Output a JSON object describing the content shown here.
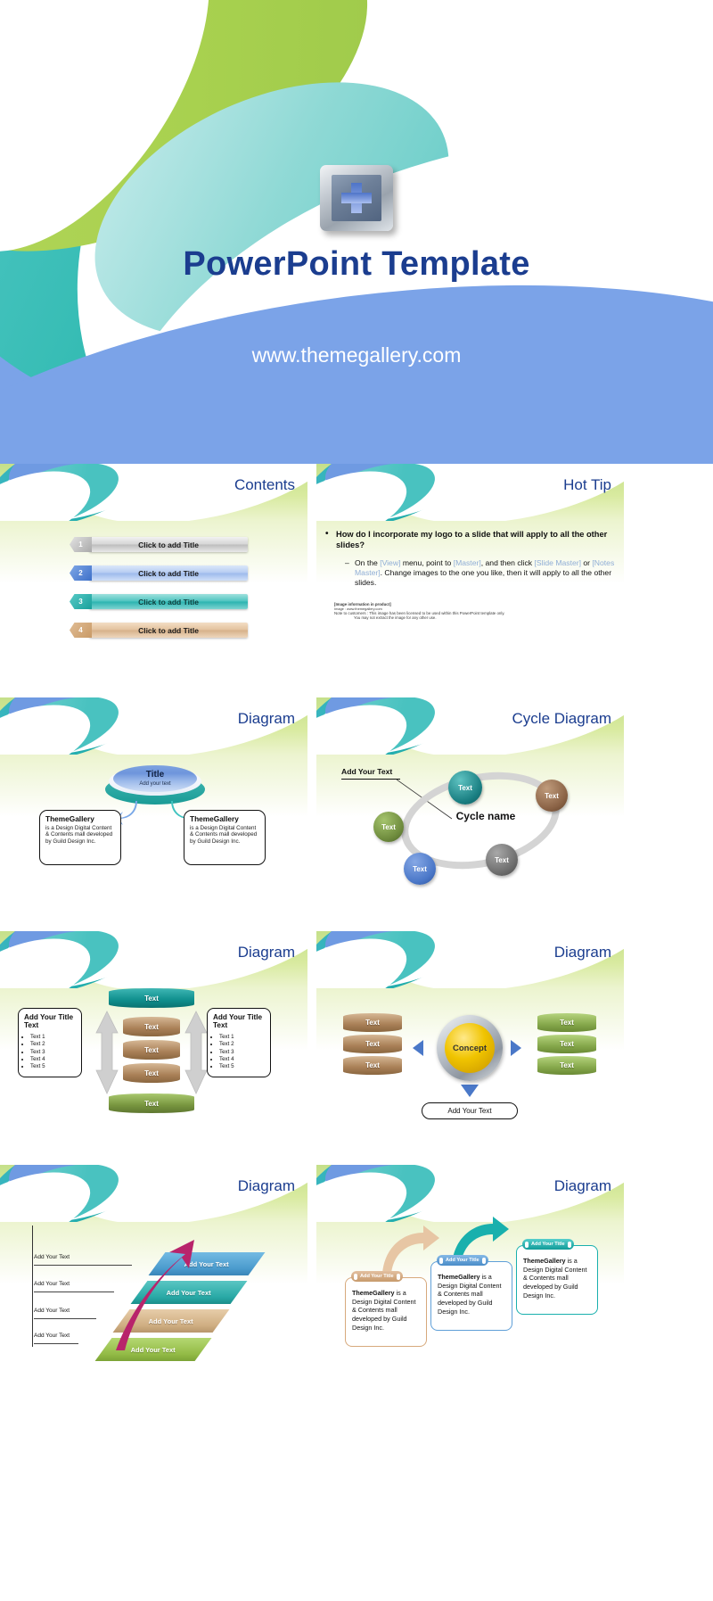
{
  "cover": {
    "title": "PowerPoint Template",
    "url": "www.themegallery.com",
    "logo_icon": "plus-badge-icon"
  },
  "slides": [
    {
      "title": "Contents",
      "items": [
        {
          "num": "1",
          "label": "Click to add Title"
        },
        {
          "num": "2",
          "label": "Click to add Title"
        },
        {
          "num": "3",
          "label": "Click to add Title"
        },
        {
          "num": "4",
          "label": "Click to add Title"
        }
      ]
    },
    {
      "title": "Hot Tip",
      "question": "How do I incorporate my logo to a slide that will apply to all the other slides?",
      "answer_parts": [
        {
          "text": "On the ",
          "placeholder": false
        },
        {
          "text": "[View]",
          "placeholder": true
        },
        {
          "text": " menu, point to ",
          "placeholder": false
        },
        {
          "text": "[Master]",
          "placeholder": true
        },
        {
          "text": ", and then click ",
          "placeholder": false
        },
        {
          "text": "[Slide Master]",
          "placeholder": true
        },
        {
          "text": " or ",
          "placeholder": false
        },
        {
          "text": "[Notes Master]",
          "placeholder": true
        },
        {
          "text": ". Change images to the one you like, then it will apply to all the other slides.",
          "placeholder": false
        }
      ],
      "notes": {
        "heading": "[Image information in product]",
        "line1": "Image : www.themegallery.com",
        "line2": "Note to customers : This image has been licensed to be used within this PowerPoint template only.",
        "line3": "You may not extract the image for any other use."
      }
    },
    {
      "title": "Diagram",
      "center": {
        "title": "Title",
        "subtitle": "Add your text"
      },
      "boxes": [
        {
          "heading": "ThemeGallery",
          "body": "is a Design Digital Content & Contents mall developed by Guild Design Inc."
        },
        {
          "heading": "ThemeGallery",
          "body": "is a Design Digital Content & Contents mall developed by Guild Design Inc."
        }
      ]
    },
    {
      "title": "Cycle Diagram",
      "callout": "Add Your Text",
      "cycle_name": "Cycle name",
      "nodes": [
        {
          "label": "Text",
          "color": "#1a7f82"
        },
        {
          "label": "Text",
          "color": "#8a6245"
        },
        {
          "label": "Text",
          "color": "#6e8b3d"
        },
        {
          "label": "Text",
          "color": "#4a77c8"
        },
        {
          "label": "Text",
          "color": "#6d6d6d"
        }
      ]
    },
    {
      "title": "Diagram",
      "cyl_top": "Text",
      "cyl_mid": [
        "Text",
        "Text",
        "Text"
      ],
      "cyl_bottom": "Text",
      "side_boxes": [
        {
          "heading": "Add Your Title Text",
          "items": [
            "Text 1",
            "Text 2",
            "Text 3",
            "Text 4",
            "Text 5"
          ]
        },
        {
          "heading": "Add Your Title Text",
          "items": [
            "Text 1",
            "Text 2",
            "Text 3",
            "Text 4",
            "Text 5"
          ]
        }
      ]
    },
    {
      "title": "Diagram",
      "concept": "Concept",
      "left_cyl": [
        "Text",
        "Text",
        "Text"
      ],
      "right_cyl": [
        "Text",
        "Text",
        "Text"
      ],
      "bottom_pill": "Add Your Text"
    },
    {
      "title": "Diagram",
      "labels": [
        "Add Your Text",
        "Add Your Text",
        "Add Your Text",
        "Add Your Text"
      ],
      "slabs": [
        {
          "label": "Add Your Text",
          "color": "#59a8d8"
        },
        {
          "label": "Add Your Text",
          "color": "#3fb3b0"
        },
        {
          "label": "Add Your Text",
          "color": "#d8b88f"
        },
        {
          "label": "Add Your Text",
          "color": "#9ec45a"
        }
      ]
    },
    {
      "title": "Diagram",
      "cards": [
        {
          "tab": "Add Your Title",
          "heading": "ThemeGallery",
          "body": " is a Design Digital Content & Contents mall developed by Guild Design Inc.",
          "color": "#d7a97c"
        },
        {
          "tab": "Add Your Title",
          "heading": "ThemeGallery",
          "body": " is a Design Digital Content & Contents mall developed by Guild Design Inc.",
          "color": "#5f9fd8"
        },
        {
          "tab": "Add Your Title",
          "heading": "ThemeGallery",
          "body": " is a Design Digital Content & Contents mall developed by Guild Design Inc.",
          "color": "#19b0ad"
        }
      ]
    }
  ],
  "colors": {
    "title_blue": "#1b3d8f",
    "cover_blue": "#7ba3e8",
    "teal": "#14a8a2",
    "green": "#a8d14f"
  }
}
